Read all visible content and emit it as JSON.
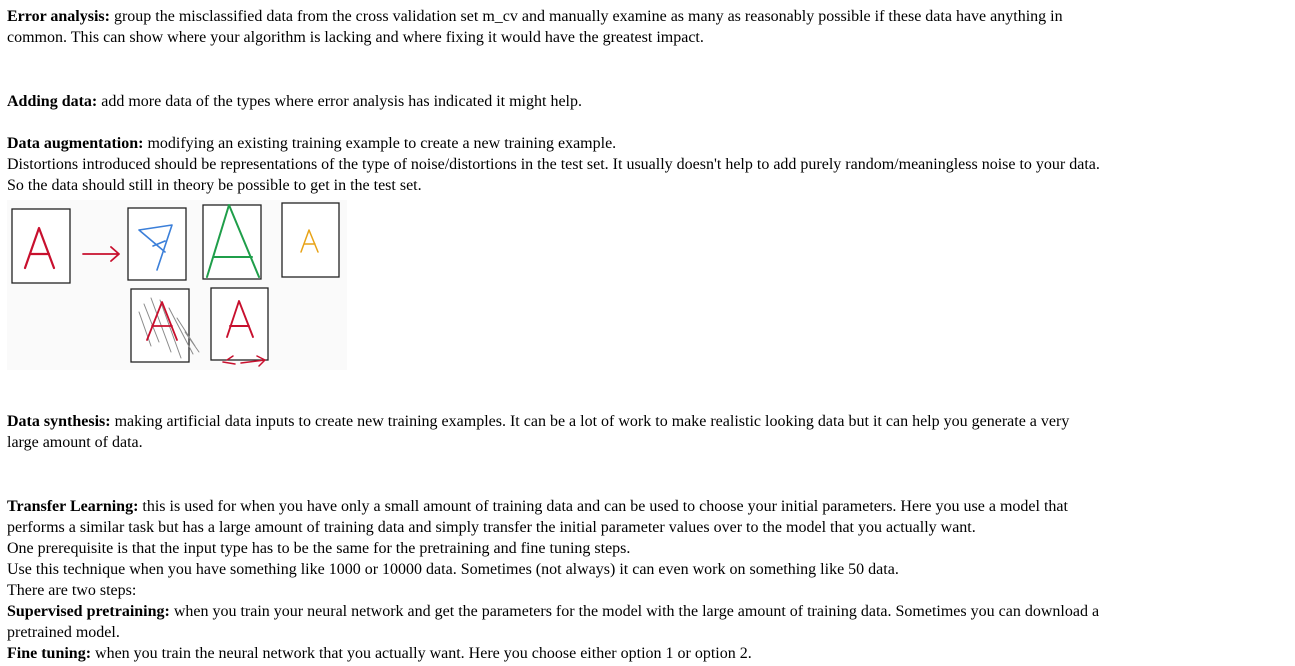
{
  "error_analysis": {
    "term": "Error analysis:",
    "line1": " group the misclassified data from the cross validation set m_cv and manually examine as many as reasonably possible if these data have anything in",
    "line2": "common. This can show where your algorithm is lacking and where fixing it would have the greatest impact."
  },
  "adding_data": {
    "term": "Adding data:",
    "line1": " add more data of the types where error analysis has indicated it might help."
  },
  "data_augmentation": {
    "term": "Data augmentation:",
    "line1": " modifying an existing training example to create a new training example.",
    "line2": "Distortions introduced should be representations of the type of noise/distortions in the test set. It usually doesn't help to add purely random/meaningless noise to your data.",
    "line3": "So the data should still in theory be possible to get in the test set."
  },
  "figure": {
    "letter": "A",
    "colors": {
      "red": "#c8102e",
      "blue": "#3b7fd9",
      "green": "#1f9e4a",
      "orange": "#e8a317",
      "gray": "#8a8a8a",
      "frame": "#222222"
    }
  },
  "data_synthesis": {
    "term": "Data synthesis:",
    "line1": " making artificial data inputs to create new training examples. It can be a lot of work to make realistic looking data but it can help you generate a very",
    "line2": "large amount of data."
  },
  "transfer_learning": {
    "term": "Transfer Learning:",
    "line1": " this is used for when you have only a small amount of training data and can be used to choose your initial parameters. Here you use a model that",
    "line2": "performs a similar task but has a large amount of training data and simply transfer the initial parameter values over to the model that you actually want.",
    "line3": "One prerequisite is that the input type has to be the same for the pretraining and fine tuning steps.",
    "line4": "Use this technique when you have something like 1000 or 10000 data. Sometimes (not always) it can even work on something like 50 data.",
    "line5": "There are two steps:"
  },
  "supervised_pretraining": {
    "term": "Supervised pretraining:",
    "line1": " when you train your neural network and get the parameters for the model with the large amount of training data. Sometimes you can download a",
    "line2": "pretrained model."
  },
  "fine_tuning": {
    "term": "Fine tuning:",
    "line1": " when you train the neural network that you actually want. Here you choose either option 1 or option 2."
  }
}
